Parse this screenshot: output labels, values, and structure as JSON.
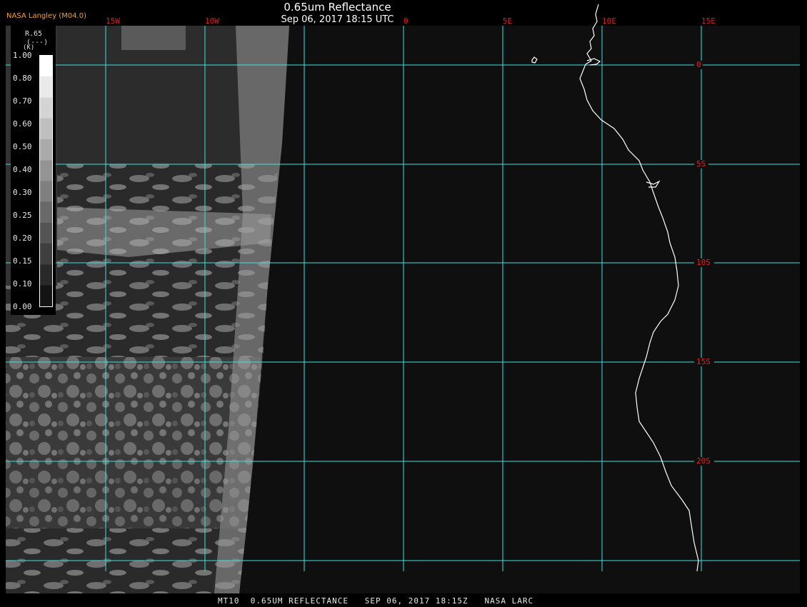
{
  "header": {
    "title": "0.65um Reflectance",
    "timestamp": "Sep 06, 2017 18:15 UTC",
    "credit": "NASA Langley (M04.0)"
  },
  "footer": {
    "text": "MT10  0.65UM REFLECTANCE   SEP 06, 2017 18:15Z   NASA LARC"
  },
  "legend": {
    "caption_line1": "R.65",
    "caption_line2": "(---)",
    "caption_line3": "(K)",
    "ticks": [
      "1.00",
      "0.80",
      "0.70",
      "0.60",
      "0.50",
      "0.40",
      "0.30",
      "0.25",
      "0.20",
      "0.15",
      "0.10",
      "0.00"
    ]
  },
  "map": {
    "longitude_labels": [
      "15W",
      "10W",
      "0",
      "5E",
      "10E",
      "15E"
    ],
    "latitude_labels": [
      "0",
      "5S",
      "10S",
      "15S",
      "20S"
    ],
    "grid_color": "#40e0e0",
    "label_color": "#e02020",
    "coastline_color": "#ffffff"
  }
}
